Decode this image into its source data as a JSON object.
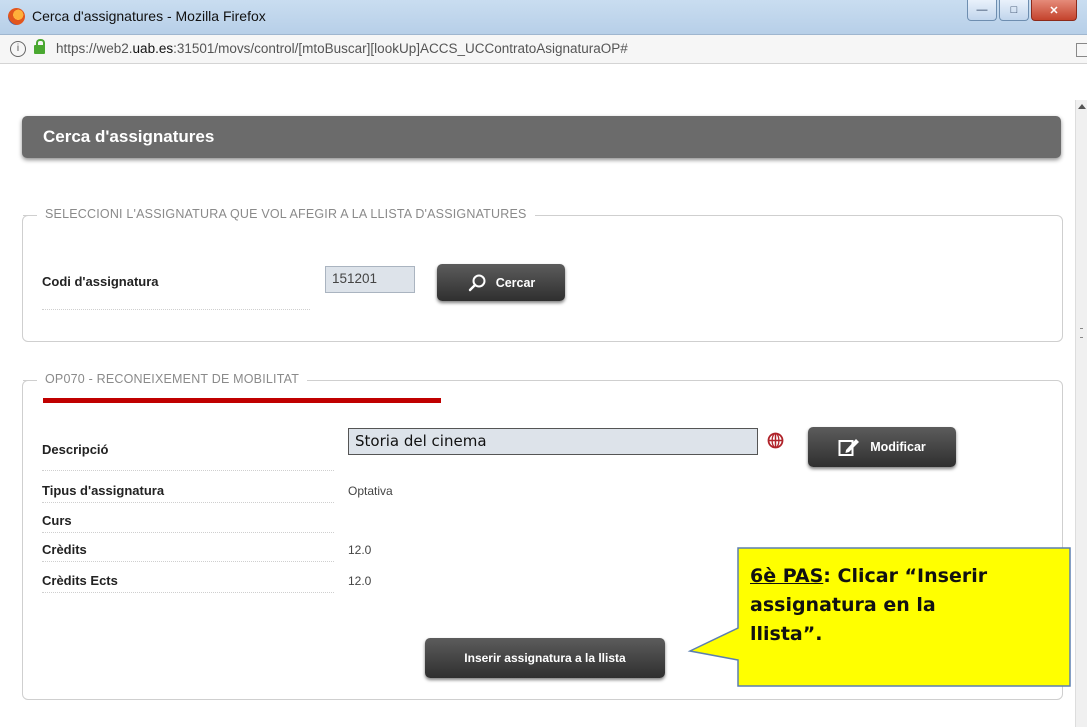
{
  "window": {
    "title": "Cerca d'assignatures  - Mozilla Firefox"
  },
  "address": {
    "url_prefix": "https://web2.",
    "url_domain": "uab.es",
    "url_suffix": ":31501/movs/control/[mtoBuscar][lookUp]ACCS_UCContratoAsignaturaOP#"
  },
  "page": {
    "title": "Cerca d'assignatures"
  },
  "search_section": {
    "legend": "SELECCIONI L'ASSIGNATURA QUE VOL AFEGIR A LA LLISTA D'ASSIGNATURES",
    "code_label": "Codi d'assignatura",
    "code_value": "151201",
    "search_button": "Cercar"
  },
  "subject_section": {
    "legend": "OP070 - RECONEIXEMENT DE MOBILITAT",
    "description_label": "Descripció",
    "description_value": "Storia del cinema",
    "modify_button": "Modificar",
    "type_label": "Tipus d'assignatura",
    "type_value": "Optativa",
    "course_label": "Curs",
    "credits_label": "Crèdits",
    "credits_value": "12.0",
    "ects_label": "Crèdits Ects",
    "ects_value": "12.0",
    "insert_button": "Inserir assignatura a la llista"
  },
  "callout": {
    "step": "6è PAS",
    "line1": ": Clicar “Inserir",
    "line2": "assignatura en la",
    "line3": "llista”."
  },
  "colors": {
    "header_bg": "#6b6b6b",
    "accent_red": "#c00000",
    "callout_bg": "#ffff00"
  }
}
